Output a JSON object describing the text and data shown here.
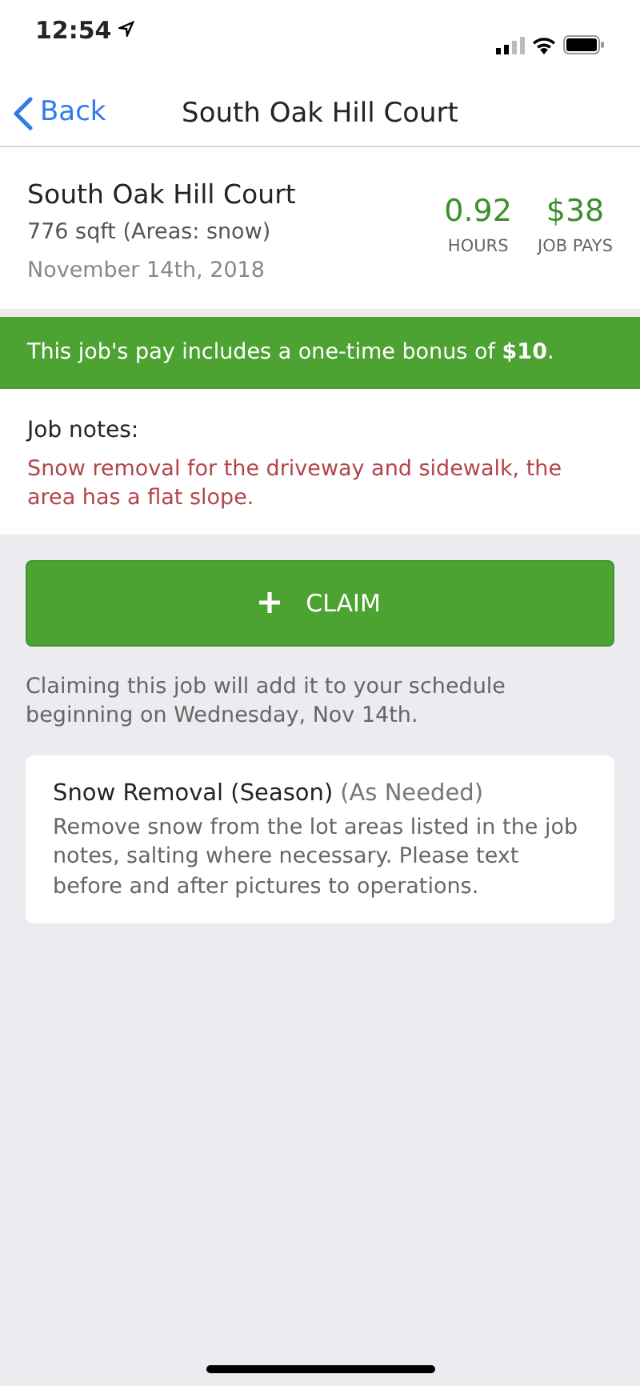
{
  "status_bar": {
    "time": "12:54"
  },
  "nav": {
    "back": "Back",
    "title": "South Oak Hill Court"
  },
  "job": {
    "name": "South Oak Hill Court",
    "size": "776 sqft (Areas: snow)",
    "date": "November 14th, 2018",
    "stats": [
      {
        "value": "0.92",
        "label": "HOURS"
      },
      {
        "value": "$38",
        "label": "JOB PAYS"
      }
    ]
  },
  "bonus_banner": "This job's pay includes a one-time bonus of **$10**.",
  "notes": {
    "label": "Job notes:",
    "text": "Snow removal for the driveway and sidewalk, the area has a flat slope."
  },
  "claim_button": "CLAIM",
  "claim_info": "Claiming this job will add it to your schedule beginning on Wednesday, Nov 14th.",
  "services": [
    {
      "name": "Snow Removal (Season)",
      "frequency": "(As Needed)",
      "description": "Remove snow from the lot areas listed in the job notes, salting where necessary. Please text before and after pictures to operations."
    }
  ]
}
